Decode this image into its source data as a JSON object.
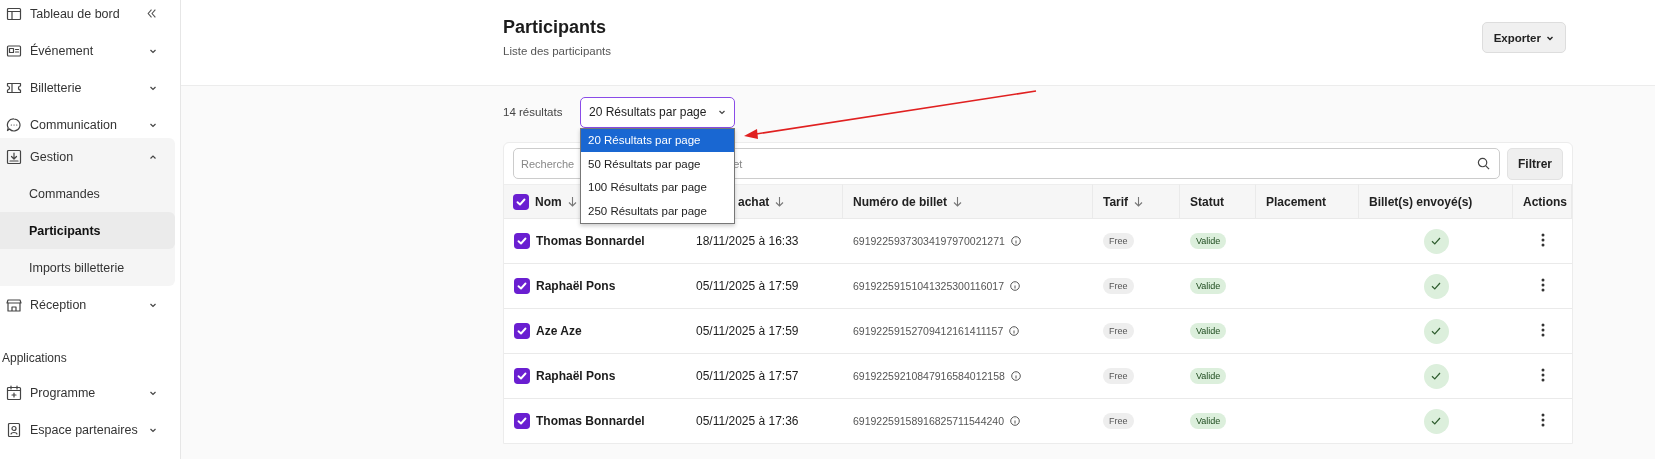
{
  "sidebar": {
    "items": [
      {
        "label": "Tableau de bord"
      },
      {
        "label": "Événement",
        "expanded": false
      },
      {
        "label": "Billetterie",
        "expanded": false
      },
      {
        "label": "Communication",
        "expanded": false
      },
      {
        "label": "Gestion",
        "expanded": true,
        "children": [
          {
            "label": "Commandes",
            "selected": false
          },
          {
            "label": "Participants",
            "selected": true
          },
          {
            "label": "Imports billetterie",
            "selected": false
          }
        ]
      },
      {
        "label": "Réception",
        "expanded": false
      }
    ],
    "section_title": "Applications",
    "app_items": [
      {
        "label": "Programme",
        "expanded": false
      },
      {
        "label": "Espace partenaires",
        "expanded": false
      }
    ]
  },
  "header": {
    "title": "Participants",
    "subtitle": "Liste des participants",
    "export_button": "Exporter"
  },
  "results_count": "14 résultats",
  "page_size": {
    "value": "20 Résultats par page",
    "open": true,
    "options": [
      {
        "label": "20 Résultats par page",
        "selected": true
      },
      {
        "label": "50 Résultats par page",
        "selected": false
      },
      {
        "label": "100 Résultats par page",
        "selected": false
      },
      {
        "label": "250 Résultats par page",
        "selected": false
      }
    ]
  },
  "search": {
    "placeholder": "Recherche",
    "placeholder_tail": "et"
  },
  "filter_button": "Filtrer",
  "table": {
    "all_checked": true,
    "columns": [
      {
        "label": "Nom",
        "sortable": true
      },
      {
        "label": "achat",
        "sortable": true
      },
      {
        "label": "Numéro de billet",
        "sortable": true
      },
      {
        "label": "Tarif",
        "sortable": true
      },
      {
        "label": "Statut",
        "sortable": false
      },
      {
        "label": "Placement",
        "sortable": false
      },
      {
        "label": "Billet(s) envoyé(s)",
        "sortable": false
      },
      {
        "label": "Actions",
        "sortable": false
      }
    ],
    "rows": [
      {
        "checked": true,
        "name": "Thomas Bonnardel",
        "date": "18/11/2025 à 16:33",
        "ticket": "69192259373034197970021271",
        "tarif": "Free",
        "status": "Valide",
        "sent": true
      },
      {
        "checked": true,
        "name": "Raphaël Pons",
        "date": "05/11/2025 à 17:59",
        "ticket": "69192259151041325300116017",
        "tarif": "Free",
        "status": "Valide",
        "sent": true
      },
      {
        "checked": true,
        "name": "Aze Aze",
        "date": "05/11/2025 à 17:59",
        "ticket": "69192259152709412161411157",
        "tarif": "Free",
        "status": "Valide",
        "sent": true
      },
      {
        "checked": true,
        "name": "Raphaël Pons",
        "date": "05/11/2025 à 17:57",
        "ticket": "69192259210847916584012158",
        "tarif": "Free",
        "status": "Valide",
        "sent": true
      },
      {
        "checked": true,
        "name": "Thomas Bonnardel",
        "date": "05/11/2025 à 17:36",
        "ticket": "69192259158916825711544240",
        "tarif": "Free",
        "status": "Valide",
        "sent": true
      }
    ]
  },
  "annotation": {
    "arrow": true
  }
}
